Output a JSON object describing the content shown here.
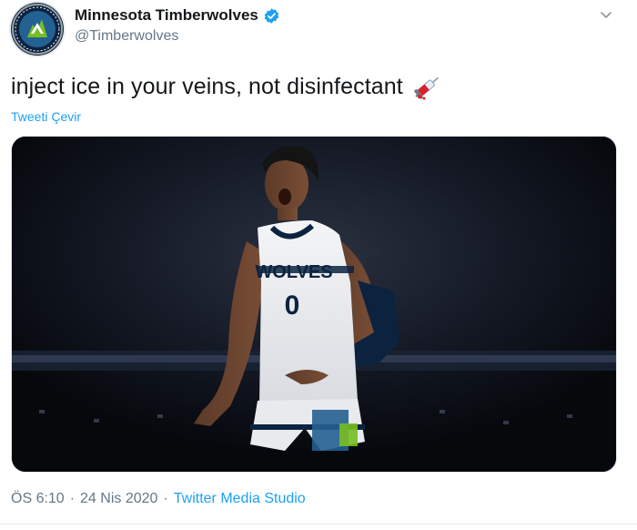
{
  "account": {
    "display_name": "Minnesota Timberwolves",
    "handle": "@Timberwolves",
    "verified": true,
    "avatar_icon": "timberwolves-logo",
    "avatar_color": "#0c2340"
  },
  "tweet": {
    "text": "inject ice in your veins, not disinfectant",
    "emoji_icon": "syringe-emoji",
    "translate_label": "Tweeti Çevir"
  },
  "media": {
    "jersey_text": "WOLVES",
    "jersey_number": "0"
  },
  "meta": {
    "time": "ÖS 6:10",
    "date": "24 Nis 2020",
    "separator": "·",
    "source": "Twitter Media Studio"
  },
  "colors": {
    "link": "#1da1f2",
    "secondary_text": "#657786",
    "jersey_trim": "#0c2340"
  }
}
